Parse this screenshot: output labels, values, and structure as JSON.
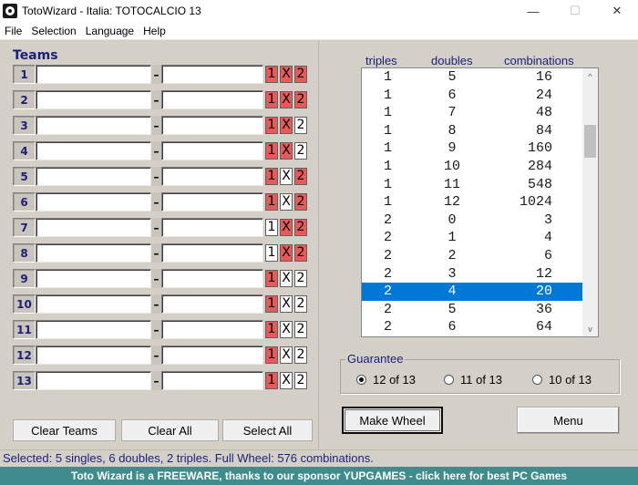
{
  "window": {
    "title": "TotoWizard - Italia: TOTOCALCIO 13",
    "minimize_glyph": "—",
    "maximize_glyph": "☐",
    "close_glyph": "✕"
  },
  "menu": [
    "File",
    "Selection",
    "Language",
    "Help"
  ],
  "teams": {
    "heading": "Teams",
    "dash": "–",
    "rows": [
      {
        "num": "1",
        "home": "",
        "away": "",
        "s1": "1",
        "sx": "X",
        "s2": "2",
        "on": [
          true,
          true,
          true
        ]
      },
      {
        "num": "2",
        "home": "",
        "away": "",
        "s1": "1",
        "sx": "X",
        "s2": "2",
        "on": [
          true,
          true,
          true
        ]
      },
      {
        "num": "3",
        "home": "",
        "away": "",
        "s1": "1",
        "sx": "X",
        "s2": "2",
        "on": [
          true,
          true,
          false
        ]
      },
      {
        "num": "4",
        "home": "",
        "away": "",
        "s1": "1",
        "sx": "X",
        "s2": "2",
        "on": [
          true,
          true,
          false
        ]
      },
      {
        "num": "5",
        "home": "",
        "away": "",
        "s1": "1",
        "sx": "X",
        "s2": "2",
        "on": [
          true,
          false,
          true
        ]
      },
      {
        "num": "6",
        "home": "",
        "away": "",
        "s1": "1",
        "sx": "X",
        "s2": "2",
        "on": [
          true,
          false,
          true
        ]
      },
      {
        "num": "7",
        "home": "",
        "away": "",
        "s1": "1",
        "sx": "X",
        "s2": "2",
        "on": [
          false,
          true,
          true
        ]
      },
      {
        "num": "8",
        "home": "",
        "away": "",
        "s1": "1",
        "sx": "X",
        "s2": "2",
        "on": [
          false,
          true,
          true
        ]
      },
      {
        "num": "9",
        "home": "",
        "away": "",
        "s1": "1",
        "sx": "X",
        "s2": "2",
        "on": [
          true,
          false,
          false
        ]
      },
      {
        "num": "10",
        "home": "",
        "away": "",
        "s1": "1",
        "sx": "X",
        "s2": "2",
        "on": [
          true,
          false,
          false
        ]
      },
      {
        "num": "11",
        "home": "",
        "away": "",
        "s1": "1",
        "sx": "X",
        "s2": "2",
        "on": [
          true,
          false,
          false
        ]
      },
      {
        "num": "12",
        "home": "",
        "away": "",
        "s1": "1",
        "sx": "X",
        "s2": "2",
        "on": [
          true,
          false,
          false
        ]
      },
      {
        "num": "13",
        "home": "",
        "away": "",
        "s1": "1",
        "sx": "X",
        "s2": "2",
        "on": [
          true,
          false,
          false
        ]
      }
    ]
  },
  "buttons": {
    "clear_teams": "Clear Teams",
    "clear_all": "Clear All",
    "select_all": "Select All",
    "make_wheel": "Make Wheel",
    "menu": "Menu"
  },
  "table": {
    "headers": {
      "triples": "triples",
      "doubles": "doubles",
      "combinations": "combinations"
    },
    "selected_index": 12,
    "rows": [
      {
        "triples": "1",
        "doubles": "5",
        "combinations": "16"
      },
      {
        "triples": "1",
        "doubles": "6",
        "combinations": "24"
      },
      {
        "triples": "1",
        "doubles": "7",
        "combinations": "48"
      },
      {
        "triples": "1",
        "doubles": "8",
        "combinations": "84"
      },
      {
        "triples": "1",
        "doubles": "9",
        "combinations": "160"
      },
      {
        "triples": "1",
        "doubles": "10",
        "combinations": "284"
      },
      {
        "triples": "1",
        "doubles": "11",
        "combinations": "548"
      },
      {
        "triples": "1",
        "doubles": "12",
        "combinations": "1024"
      },
      {
        "triples": "2",
        "doubles": "0",
        "combinations": "3"
      },
      {
        "triples": "2",
        "doubles": "1",
        "combinations": "4"
      },
      {
        "triples": "2",
        "doubles": "2",
        "combinations": "6"
      },
      {
        "triples": "2",
        "doubles": "3",
        "combinations": "12"
      },
      {
        "triples": "2",
        "doubles": "4",
        "combinations": "20"
      },
      {
        "triples": "2",
        "doubles": "5",
        "combinations": "36"
      },
      {
        "triples": "2",
        "doubles": "6",
        "combinations": "64"
      }
    ],
    "scroll_up_glyph": "^",
    "scroll_down_glyph": "v"
  },
  "guarantee": {
    "label": "Guarantee",
    "options": [
      {
        "label": "12 of 13",
        "checked": true
      },
      {
        "label": "11 of 13",
        "checked": false
      },
      {
        "label": "10 of 13",
        "checked": false
      }
    ]
  },
  "status": {
    "text": "Selected: 5 singles, 6 doubles, 2 triples.  Full Wheel: 576 combinations."
  },
  "sponsor": {
    "text": "Toto Wizard is a FREEWARE, thanks to our sponsor YUPGAMES - click here for best PC Games"
  },
  "colors": {
    "sign_on": "#e85a5a",
    "selection": "#0078d7",
    "heading_blue": "#1b1f7a",
    "sponsor_bg": "#3e8c8c"
  }
}
